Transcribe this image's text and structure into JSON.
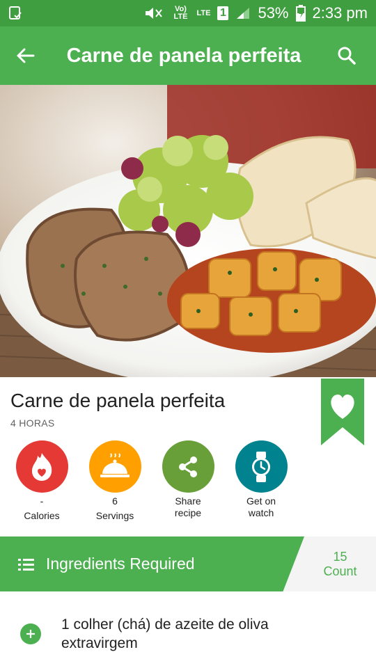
{
  "status_bar": {
    "volte": "Vo) LTE",
    "lte": "LTE",
    "sim": "1",
    "battery_pct": "53%",
    "time": "2:33 pm"
  },
  "app_bar": {
    "title": "Carne de panela perfeita"
  },
  "hero_image": {
    "subject": "pot roast slices with potatoes, salad and bread"
  },
  "recipe": {
    "title": "Carne de panela perfeita",
    "time": "4 HORAS"
  },
  "actions": {
    "calories": {
      "value": "-",
      "label": "Calories",
      "color": "#e53935"
    },
    "servings": {
      "value": "6",
      "label": "Servings",
      "color": "#ffa000"
    },
    "share": {
      "line1": "Share",
      "line2": "recipe",
      "color": "#689f38"
    },
    "watch": {
      "line1": "Get on",
      "line2": "watch",
      "color": "#00838f"
    }
  },
  "ingredients_header": {
    "title": "Ingredients Required",
    "count_value": "15",
    "count_label": "Count"
  },
  "ingredients": [
    {
      "text": "1 colher (chá) de azeite de oliva extravirgem"
    }
  ],
  "colors": {
    "status_bar": "#3f9e3f",
    "app_bar": "#4caf50",
    "accent_green": "#4caf50"
  }
}
